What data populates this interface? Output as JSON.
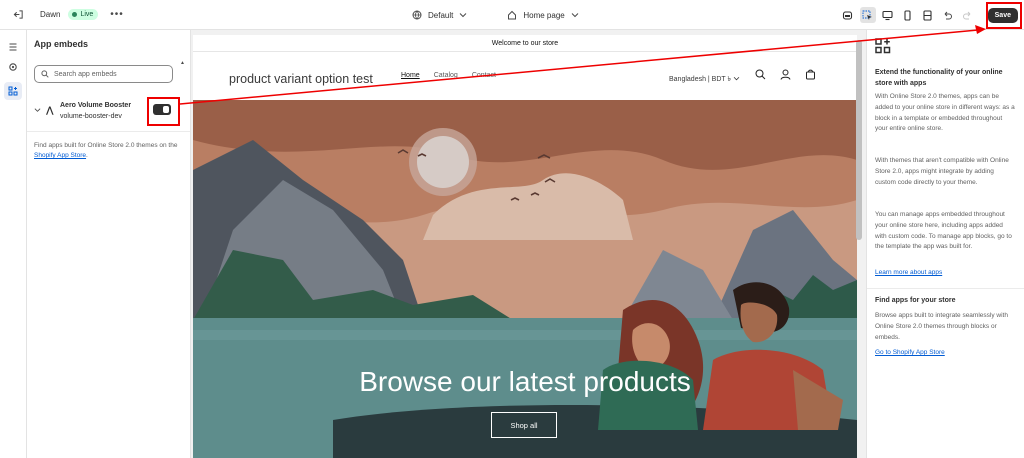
{
  "topbar": {
    "theme_name": "Dawn",
    "live_label": "Live",
    "template_select": "Default",
    "page_select": "Home page",
    "save_label": "Save"
  },
  "panel": {
    "title": "App embeds",
    "search_placeholder": "Search app embeds",
    "embed": {
      "name": "Aero Volume Booster",
      "handle": "volume-booster-dev",
      "enabled": true
    },
    "find_text": "Find apps built for Online Store 2.0 themes on the",
    "find_link": "Shopify App Store",
    "find_suffix": "."
  },
  "preview": {
    "announcement": "Welcome to our store",
    "store_title": "product variant option test",
    "nav": [
      "Home",
      "Catalog",
      "Contact"
    ],
    "currency": "Bangladesh | BDT ৳",
    "hero_title": "Browse our latest products",
    "hero_button": "Shop all"
  },
  "right_panel": {
    "heading": "Extend the functionality of your online store with apps",
    "p1": "With Online Store 2.0 themes, apps can be added to your online store in different ways: as a block in a template or embedded throughout your entire online store.",
    "p2": "With themes that aren't compatible with Online Store 2.0, apps might integrate by adding custom code directly to your theme.",
    "p3": "You can manage apps embedded throughout your online store here, including apps added with custom code. To manage app blocks, go to the template the app was built for.",
    "link1": "Learn more about apps",
    "heading2": "Find apps for your store",
    "p4": "Browse apps built to integrate seamlessly with Online Store 2.0 themes through blocks or embeds.",
    "link2": "Go to Shopify App Store"
  },
  "colors": {
    "save_button": "#303030",
    "live_badge_bg": "#cdfee1",
    "highlight": "#e00000",
    "link": "#005bd3"
  }
}
